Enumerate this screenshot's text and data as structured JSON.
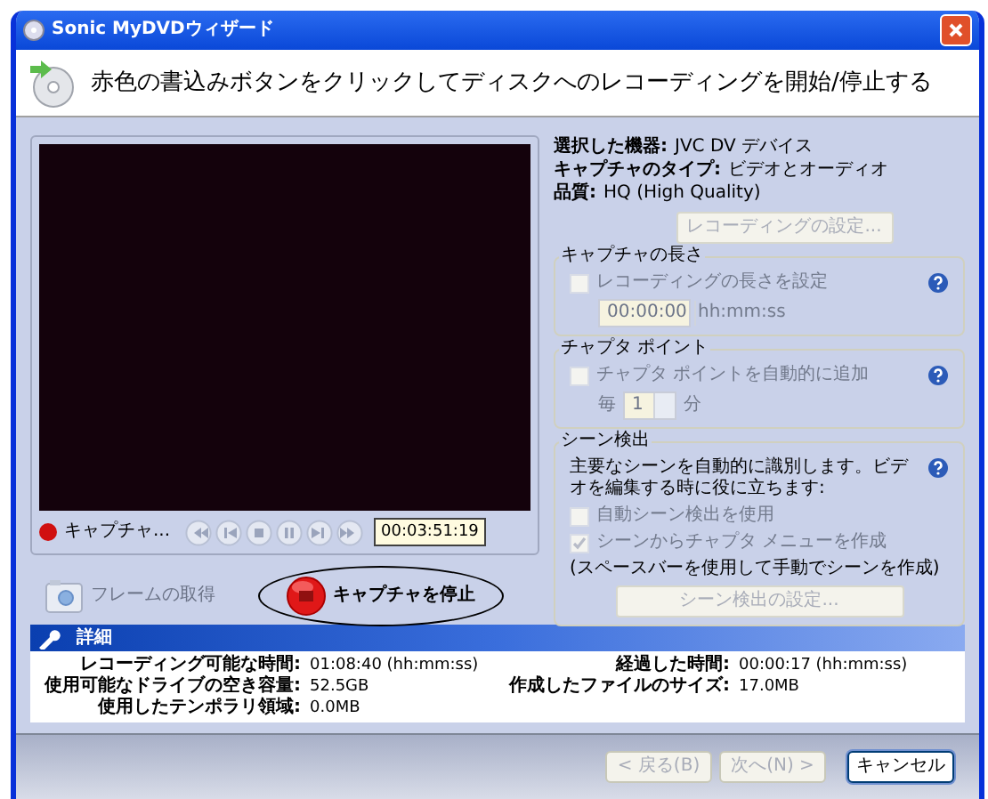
{
  "window": {
    "title": "Sonic MyDVDウィザード"
  },
  "header": {
    "instruction": "赤色の書込みボタンをクリックしてディスクへのレコーディングを開始/停止する"
  },
  "preview": {
    "status_label": "キャプチャ...",
    "recording": true,
    "timecode": "00:03:51:19"
  },
  "actions": [
    {
      "kind": "snapshot",
      "label": "フレームの取得",
      "disabled": true,
      "circled": false
    },
    {
      "kind": "stop",
      "label": "キャプチャを停止",
      "disabled": false,
      "circled": true
    }
  ],
  "info": [
    {
      "label": "選択した機器:",
      "value": "JVC DV デバイス"
    },
    {
      "label": "キャプチャのタイプ:",
      "value": "ビデオとオーディオ"
    },
    {
      "label": "品質:",
      "value": "HQ (High Quality)"
    }
  ],
  "recording_settings_button": {
    "label": "レコーディングの設定...",
    "disabled": true
  },
  "capture_length": {
    "title": "キャプチャの長さ",
    "checkbox": {
      "label": "レコーディングの長さを設定",
      "checked": false,
      "disabled": true
    },
    "time_field": {
      "value": "00:00:00",
      "disabled": true
    },
    "unit": "hh:mm:ss"
  },
  "chapter_points": {
    "title": "チャプタ ポイント",
    "checkbox": {
      "label": "チャプタ ポイントを自動的に追加",
      "checked": false,
      "disabled": true
    },
    "prefix": "毎",
    "interval_field": {
      "value": "1",
      "disabled": true
    },
    "unit": "分"
  },
  "scene_detection": {
    "title": "シーン検出",
    "description": "主要なシーンを自動的に識別します。ビデオを編集する時に役に立ちます:",
    "checkboxes": [
      {
        "label": "自動シーン検出を使用",
        "checked": false,
        "disabled": true
      },
      {
        "label": "シーンからチャプタ メニューを作成",
        "checked": true,
        "disabled": true
      }
    ],
    "note": "(スペースバーを使用して手動でシーンを作成)",
    "button": {
      "label": "シーン検出の設定...",
      "disabled": true
    }
  },
  "details": {
    "title": "詳細",
    "left": [
      {
        "label": "レコーディング可能な時間:",
        "value": "01:08:40 (hh:mm:ss)"
      },
      {
        "label": "使用可能なドライブの空き容量:",
        "value": "52.5GB"
      },
      {
        "label": "使用したテンポラリ領域:",
        "value": "0.0MB"
      }
    ],
    "right": [
      {
        "label": "経過した時間:",
        "value": "00:00:17 (hh:mm:ss)"
      },
      {
        "label": "作成したファイルのサイズ:",
        "value": "17.0MB"
      }
    ]
  },
  "footer_buttons": [
    {
      "label": "< 戻る(B)",
      "disabled": true,
      "default": false
    },
    {
      "label": "次へ(N) >",
      "disabled": true,
      "default": false
    },
    {
      "label": "キャンセル",
      "disabled": false,
      "default": true
    }
  ]
}
